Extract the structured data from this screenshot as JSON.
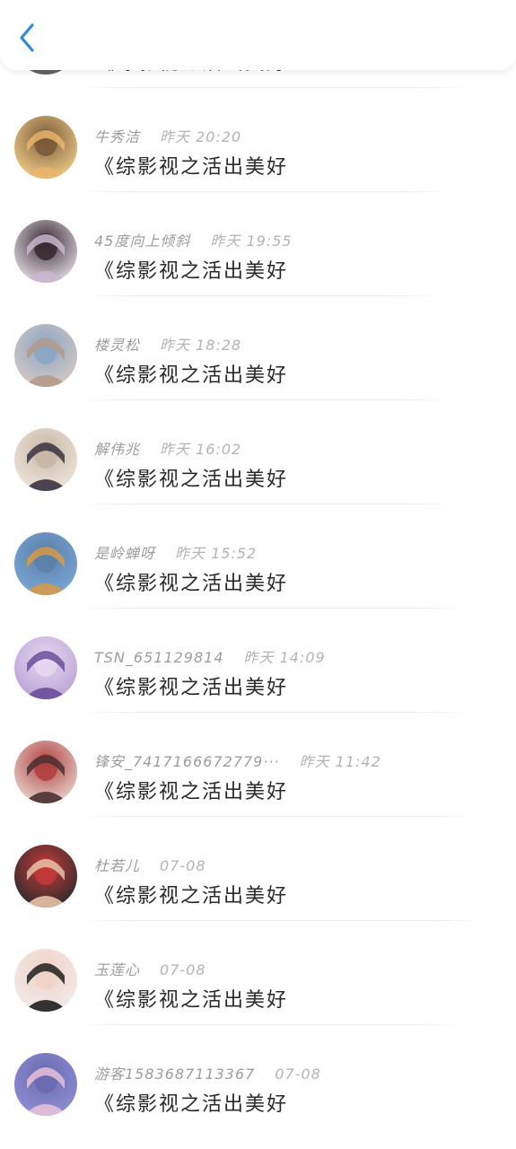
{
  "header": {
    "back_icon": "chevron-left-icon",
    "accent": "#2e8bd8"
  },
  "items": [
    {
      "name": "",
      "time": "",
      "title": "《综影视之活出美好",
      "avatar_colors": [
        "#cfcfcf",
        "#555555",
        "#eeeeee"
      ]
    },
    {
      "name": "牛秀洁",
      "time": "昨天 20:20",
      "title": "《综影视之活出美好",
      "avatar_colors": [
        "#f3d08a",
        "#e9b56a",
        "#7a5a3a"
      ]
    },
    {
      "name": "45度向上倾斜",
      "time": "昨天 19:55",
      "title": "《综影视之活出美好",
      "avatar_colors": [
        "#e8e0ea",
        "#c9b7cf",
        "#3a2a32"
      ]
    },
    {
      "name": "楼灵松",
      "time": "昨天 18:28",
      "title": "《综影视之活出美好",
      "avatar_colors": [
        "#d9c9c3",
        "#b59a8a",
        "#8aa6c4"
      ]
    },
    {
      "name": "解伟兆",
      "time": "昨天 16:02",
      "title": "《综影视之活出美好",
      "avatar_colors": [
        "#f0e6dc",
        "#3a3240",
        "#c8b7a6"
      ]
    },
    {
      "name": "是岭蝉呀",
      "time": "昨天 15:52",
      "title": "《综影视之活出美好",
      "avatar_colors": [
        "#7aa7d6",
        "#d69a4a",
        "#5b7fa8"
      ]
    },
    {
      "name": "TSN_651129814",
      "time": "昨天 14:09",
      "title": "《综影视之活出美好",
      "avatar_colors": [
        "#b9a2d6",
        "#6a4e9a",
        "#e6d7f0"
      ]
    },
    {
      "name": "锋安_7417166672779···",
      "time": "昨天 11:42",
      "title": "《综影视之活出美好",
      "avatar_colors": [
        "#e9d7cf",
        "#4a3030",
        "#b04040"
      ]
    },
    {
      "name": "杜若儿",
      "time": "07-08",
      "title": "《综影视之活出美好",
      "avatar_colors": [
        "#2a2a2a",
        "#e8c2a8",
        "#c23a3a"
      ]
    },
    {
      "name": "玉莲心",
      "time": "07-08",
      "title": "《综影视之活出美好",
      "avatar_colors": [
        "#f2eaea",
        "#1e1e1e",
        "#f0d3c6"
      ]
    },
    {
      "name": "游客1583687113367",
      "time": "07-08",
      "title": "《综影视之活出美好",
      "avatar_colors": [
        "#8f8fd6",
        "#e6c1d6",
        "#6a6ab0"
      ]
    }
  ]
}
